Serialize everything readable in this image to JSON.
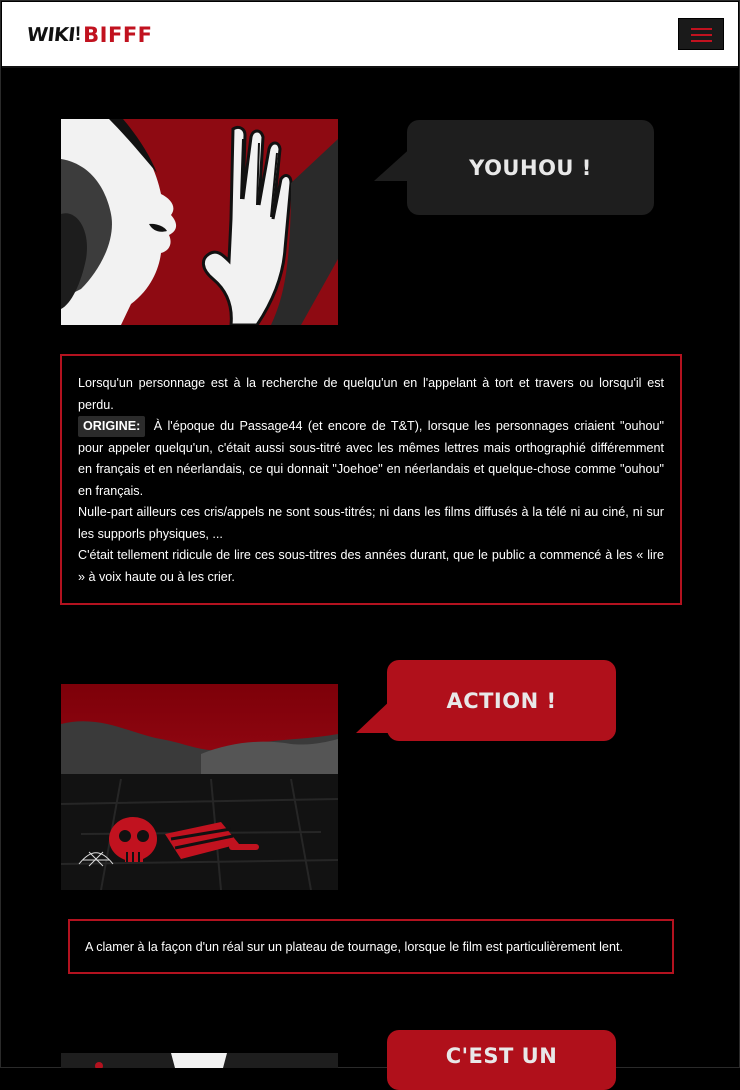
{
  "header": {
    "logo_wiki": "WIKI",
    "logo_bang": "!",
    "logo_bifff": "BIFFF"
  },
  "panels": [
    {
      "bubble": "YOUHOU !",
      "bubble_color": "#1e1e1e",
      "paragraphs": [
        "Lorsqu'un personnage est à la recherche de quelqu'un en l'appelant à tort et travers ou lorsqu'il est perdu.",
        "À l'époque du Passage44 (et encore de T&T), lorsque les personnages criaient \"ouhou\" pour appeler quelqu'un, c'était aussi sous-titré avec les mêmes lettres mais orthographié différemment en français et en néerlandais, ce qui donnait \"Joehoe\" en néerlandais et quelque-chose comme \"ouhou\" en français.",
        "Nulle-part ailleurs ces cris/appels ne sont sous-titrés; ni dans les films diffusés à la télé ni au ciné, ni sur les supporls physiques, ...",
        "C'était tellement ridicule de lire ces sous-titres des années durant, que le public a commencé à les « lire » à voix haute ou à les crier."
      ],
      "origin_label": "ORIGINE:"
    },
    {
      "bubble": "ACTION !",
      "bubble_color": "#b0101b",
      "text": "A clamer à la façon d'un réal sur un plateau de tournage, lorsque le film est particulièrement lent."
    },
    {
      "bubble": "C'EST UN",
      "bubble_color": "#b0101b"
    }
  ],
  "colors": {
    "accent": "#c1121f",
    "border": "#b3121f",
    "background": "#000000"
  }
}
